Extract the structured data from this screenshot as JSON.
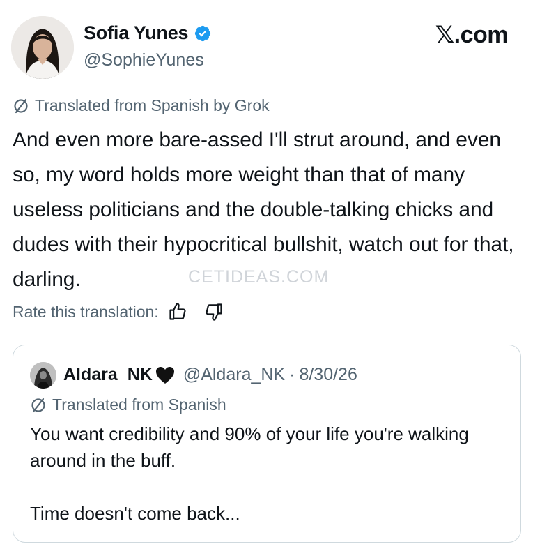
{
  "header": {
    "display_name": "Sofia Yunes",
    "handle": "@SophieYunes",
    "brand": "𝕏.com"
  },
  "translation": {
    "label": "Translated from Spanish by Grok",
    "text": "And even more bare-assed I'll strut around, and even so, my word holds more weight than that of many useless politicians and the double-talking chicks and dudes with their hypocritical bullshit, watch out for that, darling.",
    "rate_label": "Rate this translation:"
  },
  "watermark": "CETIDEAS.COM",
  "quote": {
    "name": "Aldara_NK",
    "handle": "@Aldara_NK",
    "date": "8/30/26",
    "translated_label": "Translated from Spanish",
    "text": "You want credibility and 90% of your life you're walking around in the buff.\n\nTime doesn't come back..."
  },
  "colors": {
    "text": "#0f1419",
    "secondary": "#536471",
    "verified": "#1d9bf0",
    "border": "#cfd9de"
  },
  "icons": [
    "verified-badge-icon",
    "grok-slash-icon",
    "thumbs-up-icon",
    "thumbs-down-icon",
    "black-heart-icon"
  ]
}
